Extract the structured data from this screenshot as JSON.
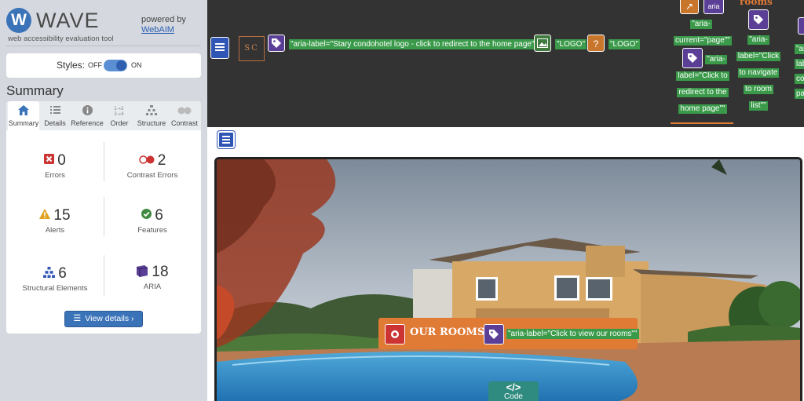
{
  "wave": {
    "logo_letter": "W",
    "logo_text": "WAVE",
    "tagline": "web accessibility evaluation tool",
    "powered_by": "powered by",
    "webaim": "WebAIM",
    "styles": {
      "label": "Styles:",
      "off": "OFF",
      "on": "ON",
      "state": "on"
    },
    "summary_title": "Summary",
    "tabs": [
      {
        "label": "Summary",
        "icon": "home-icon"
      },
      {
        "label": "Details",
        "icon": "list-icon"
      },
      {
        "label": "Reference",
        "icon": "info-icon"
      },
      {
        "label": "Order",
        "icon": "order-icon"
      },
      {
        "label": "Structure",
        "icon": "structure-icon"
      },
      {
        "label": "Contrast",
        "icon": "contrast-icon"
      }
    ],
    "stats": {
      "errors": {
        "count": "0",
        "label": "Errors"
      },
      "contrast_errors": {
        "count": "2",
        "label": "Contrast Errors"
      },
      "alerts": {
        "count": "15",
        "label": "Alerts"
      },
      "features": {
        "count": "6",
        "label": "Features"
      },
      "structural": {
        "count": "6",
        "label": "Structural Elements"
      },
      "aria": {
        "count": "18",
        "label": "ARIA"
      }
    },
    "view_details": "View details ›",
    "colors": {
      "accent": "#3b73b9",
      "error": "#cc3333",
      "alert": "#e0a020",
      "feature": "#3f8a3f",
      "aria": "#5b3f96"
    }
  },
  "page": {
    "logo_text": "SC",
    "aria_logo": "\"aria-label=\"Stary condohotel logo - click to redirect to the home page\"\"",
    "alt_logo_1": "\"LOGO\"",
    "alt_logo_2": "\"LOGO\"",
    "nav1_tag": "aria",
    "nav1_lines_a": [
      "\"aria-",
      "current=\"page\"\""
    ],
    "nav1_lines_b": [
      "\"aria-",
      "label=\"Click to",
      "redirect to the",
      "home page\"\""
    ],
    "nav2_heading": "rooms",
    "nav2_lines": [
      "\"aria-",
      "label=\"Click",
      "to navigate",
      "to room",
      "list\"\""
    ],
    "nav3_lines": [
      "\"ar",
      "lab",
      "co",
      "pa"
    ],
    "cta_text": "OUR ROOMS!",
    "cta_aria": "\"aria-label=\"Click to view our rooms\"\"",
    "code_icon": "</>",
    "code_label": "Code"
  }
}
